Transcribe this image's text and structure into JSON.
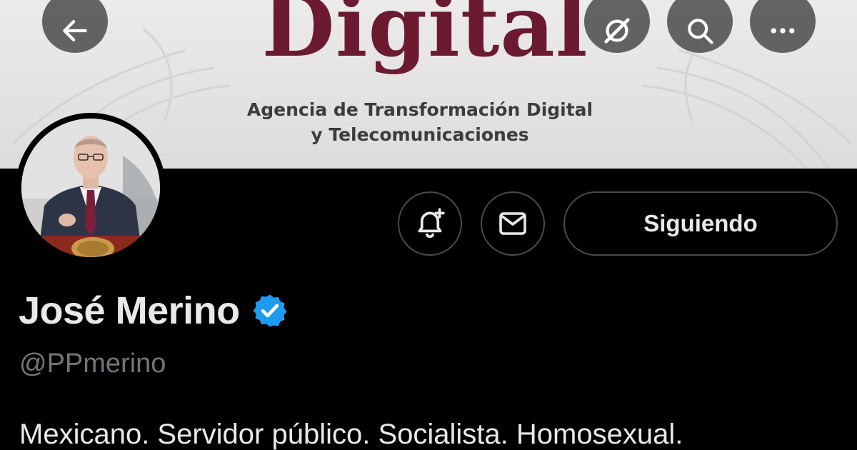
{
  "banner": {
    "title": "Digital",
    "subtitle_line1": "Agencia de Transformación Digital",
    "subtitle_line2": "y Telecomunicaciones",
    "title_color": "#6b1a30"
  },
  "top_nav": {
    "back_icon": "arrow-left-icon",
    "grok_icon": "grok-icon",
    "search_icon": "search-icon",
    "more_icon": "more-horizontal-icon"
  },
  "actions": {
    "notify_icon": "bell-plus-icon",
    "message_icon": "envelope-icon",
    "following_label": "Siguiendo"
  },
  "profile": {
    "display_name": "José Merino",
    "verified_color": "#1d9bf0",
    "handle": "@PPmerino",
    "bio": "Mexicano. Servidor público. Socialista. Homosexual."
  },
  "theme": {
    "background": "#000000",
    "text_primary": "#e7e9ea",
    "text_secondary": "#71767b",
    "border": "#4a4a4a"
  }
}
